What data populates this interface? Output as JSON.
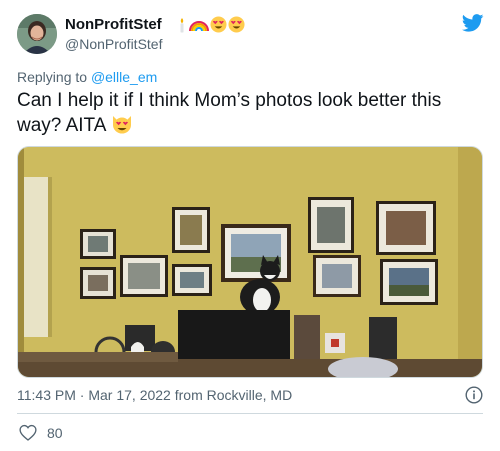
{
  "author": {
    "display_name": "NonProfitStef",
    "handle": "@NonProfitStef",
    "name_emojis": [
      "candle-emoji",
      "rainbow-emoji",
      "heart-eyes-emoji",
      "heart-eyes-emoji"
    ]
  },
  "reply": {
    "prefix": "Replying to",
    "mention": "@ellle_em"
  },
  "tweet": {
    "text": "Can I help it if I think Mom’s photos look better this way? AITA",
    "trailing_emoji": "heart-eyes-cat-emoji"
  },
  "photo": {
    "description_icon": "photo-of-cat-in-front-of-picture-frames"
  },
  "meta": {
    "time": "11:43 PM",
    "separator": "·",
    "date": "Mar 17, 2022",
    "location": "from Rockville, MD"
  },
  "stats": {
    "likes": "80"
  },
  "colors": {
    "accent": "#1d9bf0",
    "secondary_text": "#536471",
    "divider": "#cfd9de"
  }
}
